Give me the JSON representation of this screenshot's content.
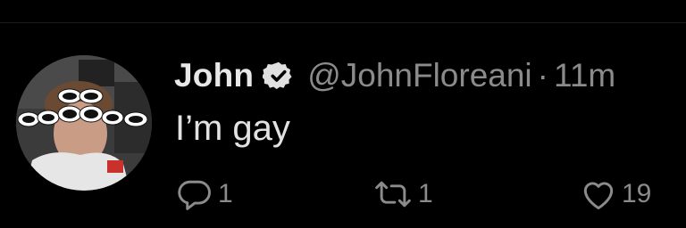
{
  "tweet": {
    "display_name": "John",
    "handle": "@JohnFloreani",
    "separator": "·",
    "time": "11m",
    "text": "I’m gay",
    "reply_count": "1",
    "retweet_count": "1",
    "like_count": "19"
  },
  "icons": {
    "verified": "verified-badge-icon",
    "reply": "reply-icon",
    "retweet": "retweet-icon",
    "like": "heart-icon"
  },
  "colors": {
    "background": "#000000",
    "name": "#e8e8e8",
    "secondary": "#8b8b8b",
    "text": "#e2e2e2"
  }
}
